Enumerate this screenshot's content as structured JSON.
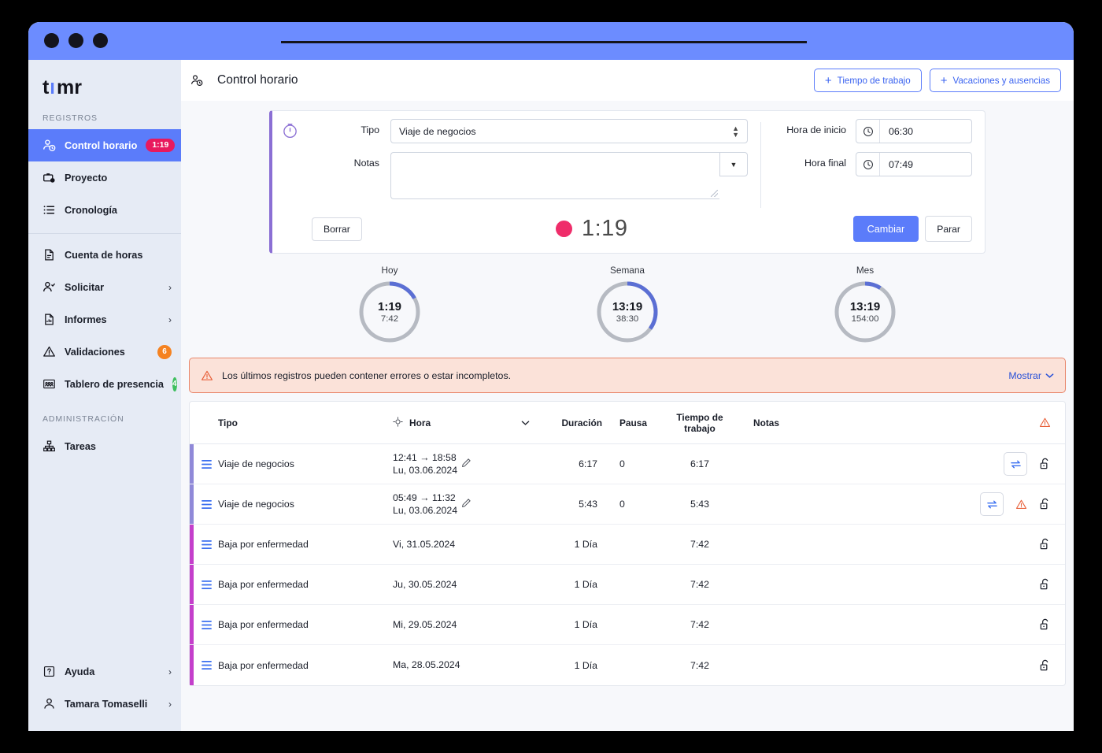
{
  "window": {
    "dots": [
      "close",
      "minimize",
      "maximize"
    ]
  },
  "sidebar": {
    "logo": "timr",
    "section_registros": "REGISTROS",
    "section_admin": "ADMINISTRACIÓN",
    "items": [
      {
        "label": "Control horario",
        "icon": "user-clock-icon",
        "badge": "1:19",
        "badge_color": "#e8195e",
        "active": true
      },
      {
        "label": "Proyecto",
        "icon": "briefcase-clock-icon"
      },
      {
        "label": "Cronología",
        "icon": "list-icon"
      },
      {
        "label": "Cuenta de horas",
        "icon": "document-icon"
      },
      {
        "label": "Solicitar",
        "icon": "user-check-icon",
        "chevron": "›"
      },
      {
        "label": "Informes",
        "icon": "report-icon",
        "chevron": "›"
      },
      {
        "label": "Validaciones",
        "icon": "warning-triangle-icon",
        "badge": "6",
        "badge_color": "#f58220"
      },
      {
        "label": "Tablero de presencia",
        "icon": "presence-board-icon",
        "badge": "4",
        "badge_color": "#3fbf5f"
      },
      {
        "label": "Tareas",
        "icon": "hierarchy-icon"
      }
    ],
    "footer_items": [
      {
        "label": "Ayuda",
        "icon": "help-icon",
        "chevron": "›"
      },
      {
        "label": "Tamara Tomaselli",
        "icon": "user-icon",
        "chevron": "›"
      }
    ]
  },
  "header": {
    "title": "Control horario",
    "icon": "user-clock-icon",
    "buttons": [
      {
        "label": "Tiempo de trabajo",
        "icon": "plus-icon"
      },
      {
        "label": "Vacaciones y ausencias",
        "icon": "plus-icon"
      }
    ]
  },
  "timer_card": {
    "accent_color": "#8b6fd4",
    "icon": "stopwatch-icon",
    "tipo_label": "Tipo",
    "tipo_value": "Viaje de negocios",
    "notas_label": "Notas",
    "notas_value": "",
    "hora_inicio_label": "Hora de inicio",
    "hora_inicio_value": "06:30",
    "hora_final_label": "Hora final",
    "hora_final_value": "07:49",
    "borrar_label": "Borrar",
    "running_time": "1:19",
    "record_color": "#ef2d6a",
    "cambiar_label": "Cambiar",
    "parar_label": "Parar"
  },
  "stats": [
    {
      "caption": "Hoy",
      "value": "1:19",
      "target": "7:42",
      "percent": 17
    },
    {
      "caption": "Semana",
      "value": "13:19",
      "target": "38:30",
      "percent": 35
    },
    {
      "caption": "Mes",
      "value": "13:19",
      "target": "154:00",
      "percent": 9
    }
  ],
  "alert": {
    "icon": "warning-triangle-icon",
    "message": "Los últimos registros pueden contener errores o estar incompletos.",
    "action_label": "Mostrar",
    "action_icon": "chevron-down-icon"
  },
  "table": {
    "columns": {
      "tipo": "Tipo",
      "hora": "Hora",
      "duracion": "Duración",
      "pausa": "Pausa",
      "tiempo_trabajo_l1": "Tiempo de",
      "tiempo_trabajo_l2": "trabajo",
      "notas": "Notas"
    },
    "rows": [
      {
        "bar_color": "#9089d8",
        "tipo": "Viaje de negocios",
        "hora_range": "12:41 → 18:58",
        "hora_date": "Lu, 03.06.2024",
        "editable": true,
        "duracion": "6:17",
        "pausa": "0",
        "tiempo_trabajo": "6:17",
        "notas": "",
        "has_swap": true,
        "has_warning": false,
        "has_lock": true
      },
      {
        "bar_color": "#9089d8",
        "tipo": "Viaje de negocios",
        "hora_range": "05:49 → 11:32",
        "hora_date": "Lu, 03.06.2024",
        "editable": true,
        "duracion": "5:43",
        "pausa": "0",
        "tiempo_trabajo": "5:43",
        "notas": "",
        "has_swap": true,
        "has_warning": true,
        "has_lock": true
      },
      {
        "bar_color": "#c43fcb",
        "tipo": "Baja por enfermedad",
        "hora_range": "",
        "hora_date": "Vi, 31.05.2024",
        "editable": false,
        "duracion": "1 Día",
        "pausa": "",
        "tiempo_trabajo": "7:42",
        "notas": "",
        "has_swap": false,
        "has_warning": false,
        "has_lock": true
      },
      {
        "bar_color": "#c43fcb",
        "tipo": "Baja por enfermedad",
        "hora_range": "",
        "hora_date": "Ju, 30.05.2024",
        "editable": false,
        "duracion": "1 Día",
        "pausa": "",
        "tiempo_trabajo": "7:42",
        "notas": "",
        "has_swap": false,
        "has_warning": false,
        "has_lock": true
      },
      {
        "bar_color": "#c43fcb",
        "tipo": "Baja por enfermedad",
        "hora_range": "",
        "hora_date": "Mi, 29.05.2024",
        "editable": false,
        "duracion": "1 Día",
        "pausa": "",
        "tiempo_trabajo": "7:42",
        "notas": "",
        "has_swap": false,
        "has_warning": false,
        "has_lock": true
      },
      {
        "bar_color": "#c43fcb",
        "tipo": "Baja por enfermedad",
        "hora_range": "",
        "hora_date": "Ma, 28.05.2024",
        "editable": false,
        "duracion": "1 Día",
        "pausa": "",
        "tiempo_trabajo": "7:42",
        "notas": "",
        "has_swap": false,
        "has_warning": false,
        "has_lock": true
      }
    ]
  }
}
